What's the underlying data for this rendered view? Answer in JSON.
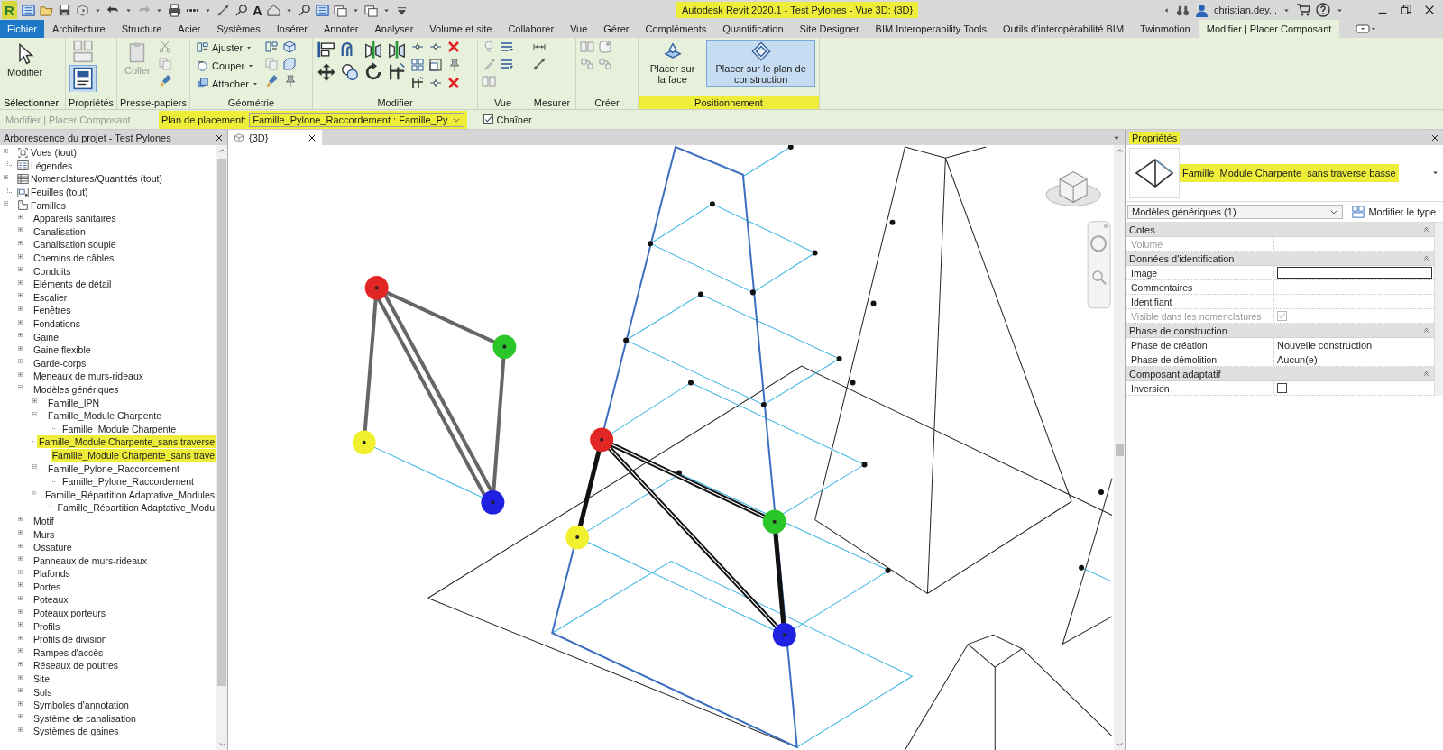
{
  "title_bar": {
    "logo": "R",
    "text_tool": "A",
    "title": "Autodesk Revit 2020.1 - Test Pylones - Vue 3D: {3D}",
    "title_highlighted": true,
    "user": "christian.dey..."
  },
  "menu_tabs": [
    {
      "label": "Fichier",
      "kind": "file",
      "selected": false
    },
    {
      "label": "Architecture",
      "kind": "tab",
      "selected": false
    },
    {
      "label": "Structure",
      "kind": "tab",
      "selected": false
    },
    {
      "label": "Acier",
      "kind": "tab",
      "selected": false
    },
    {
      "label": "Systèmes",
      "kind": "tab",
      "selected": false
    },
    {
      "label": "Insérer",
      "kind": "tab",
      "selected": false
    },
    {
      "label": "Annoter",
      "kind": "tab",
      "selected": false
    },
    {
      "label": "Analyser",
      "kind": "tab",
      "selected": false
    },
    {
      "label": "Volume et site",
      "kind": "tab",
      "selected": false
    },
    {
      "label": "Collaborer",
      "kind": "tab",
      "selected": false
    },
    {
      "label": "Vue",
      "kind": "tab",
      "selected": false
    },
    {
      "label": "Gérer",
      "kind": "tab",
      "selected": false
    },
    {
      "label": "Compléments",
      "kind": "tab",
      "selected": false
    },
    {
      "label": "Quantification",
      "kind": "tab",
      "selected": false
    },
    {
      "label": "Site Designer",
      "kind": "tab",
      "selected": false
    },
    {
      "label": "BIM Interoperability Tools",
      "kind": "tab",
      "selected": false
    },
    {
      "label": "Outils d'interopérabilité BIM",
      "kind": "tab",
      "selected": false
    },
    {
      "label": "Twinmotion",
      "kind": "tab",
      "selected": false
    },
    {
      "label": "Modifier | Placer Composant",
      "kind": "tab",
      "selected": true
    }
  ],
  "ribbon": {
    "panels": [
      {
        "label": "Sélectionner",
        "has_menu": true,
        "highlighted": false,
        "tools": [
          {
            "label": "Modifier",
            "disabled": false,
            "selected": false,
            "has_menu": false
          }
        ]
      },
      {
        "label": "Propriétés",
        "has_menu": false,
        "highlighted": false,
        "button_selected": true
      },
      {
        "label": "Presse-papiers",
        "has_menu": false,
        "highlighted": false,
        "tools": [
          {
            "label": "Coller",
            "disabled": true,
            "selected": false,
            "has_menu": false
          }
        ]
      },
      {
        "label": "Géométrie",
        "has_menu": false,
        "highlighted": false,
        "tools": [
          {
            "label": "Ajuster",
            "disabled": false,
            "selected": false,
            "has_menu": true
          },
          {
            "label": "Couper",
            "disabled": false,
            "selected": false,
            "has_menu": true
          },
          {
            "label": "Attacher",
            "disabled": false,
            "selected": false,
            "has_menu": true
          }
        ]
      },
      {
        "label": "Modifier",
        "has_menu": false,
        "highlighted": false
      },
      {
        "label": "Vue",
        "has_menu": false,
        "highlighted": false
      },
      {
        "label": "Mesurer",
        "has_menu": false,
        "highlighted": false
      },
      {
        "label": "Créer",
        "has_menu": false,
        "highlighted": false
      },
      {
        "label": "Positionnement",
        "has_menu": false,
        "highlighted": true,
        "tools": [
          {
            "label": "Placer sur la face",
            "disabled": false,
            "selected": false,
            "has_menu": false
          },
          {
            "label": "Placer sur le plan de construction",
            "disabled": false,
            "selected": true,
            "has_menu": false
          }
        ]
      }
    ]
  },
  "options_bar": {
    "context": "Modifier | Placer Composant",
    "context_disabled": true,
    "placement_label": "Plan de placement:",
    "placement_highlighted": true,
    "placement_value": "Famille_Pylone_Raccordement : Famille_Py",
    "chain": {
      "label": "Chaîner",
      "checked": true
    }
  },
  "project_browser": {
    "title": "Arborescence du projet - Test Pylones",
    "items": [
      {
        "label": "Vues (tout)",
        "kind": "group",
        "expanded": false,
        "highlighted": false
      },
      {
        "label": "Légendes",
        "kind": "leaf",
        "highlighted": false
      },
      {
        "label": "Nomenclatures/Quantités (tout)",
        "kind": "group",
        "expanded": false,
        "highlighted": false
      },
      {
        "label": "Feuilles (tout)",
        "kind": "leaf",
        "highlighted": false
      },
      {
        "label": "Familles",
        "kind": "group",
        "expanded": true,
        "highlighted": false,
        "children": [
          {
            "label": "Appareils sanitaires",
            "kind": "group",
            "expanded": false,
            "highlighted": false
          },
          {
            "label": "Canalisation",
            "kind": "group",
            "expanded": false,
            "highlighted": false
          },
          {
            "label": "Canalisation souple",
            "kind": "group",
            "expanded": false,
            "highlighted": false
          },
          {
            "label": "Chemins de câbles",
            "kind": "group",
            "expanded": false,
            "highlighted": false
          },
          {
            "label": "Conduits",
            "kind": "group",
            "expanded": false,
            "highlighted": false
          },
          {
            "label": "Eléments de détail",
            "kind": "group",
            "expanded": false,
            "highlighted": false
          },
          {
            "label": "Escalier",
            "kind": "group",
            "expanded": false,
            "highlighted": false
          },
          {
            "label": "Fenêtres",
            "kind": "group",
            "expanded": false,
            "highlighted": false
          },
          {
            "label": "Fondations",
            "kind": "group",
            "expanded": false,
            "highlighted": false
          },
          {
            "label": "Gaine",
            "kind": "group",
            "expanded": false,
            "highlighted": false
          },
          {
            "label": "Gaine flexible",
            "kind": "group",
            "expanded": false,
            "highlighted": false
          },
          {
            "label": "Garde-corps",
            "kind": "group",
            "expanded": false,
            "highlighted": false
          },
          {
            "label": "Meneaux de murs-rideaux",
            "kind": "group",
            "expanded": false,
            "highlighted": false
          },
          {
            "label": "Modèles génériques",
            "kind": "group",
            "expanded": true,
            "highlighted": false,
            "children": [
              {
                "label": "Famille_IPN",
                "kind": "group",
                "expanded": false,
                "highlighted": false
              },
              {
                "label": "Famille_Module Charpente",
                "kind": "group",
                "expanded": true,
                "highlighted": false,
                "children": [
                  {
                    "label": "Famille_Module Charpente",
                    "kind": "leaf",
                    "highlighted": false
                  }
                ]
              },
              {
                "label": "Famille_Module Charpente_sans traverse",
                "kind": "group",
                "expanded": true,
                "highlighted": true,
                "children": [
                  {
                    "label": "Famille_Module Charpente_sans trave",
                    "kind": "leaf",
                    "highlighted": true
                  }
                ]
              },
              {
                "label": "Famille_Pylone_Raccordement",
                "kind": "group",
                "expanded": true,
                "highlighted": false,
                "children": [
                  {
                    "label": "Famille_Pylone_Raccordement",
                    "kind": "leaf",
                    "highlighted": false
                  }
                ]
              },
              {
                "label": "Famille_Répartition Adaptative_Modules",
                "kind": "group",
                "expanded": true,
                "highlighted": false,
                "children": [
                  {
                    "label": "Famille_Répartition Adaptative_Modu",
                    "kind": "leaf",
                    "highlighted": false
                  }
                ]
              }
            ]
          },
          {
            "label": "Motif",
            "kind": "group",
            "expanded": false,
            "highlighted": false
          },
          {
            "label": "Murs",
            "kind": "group",
            "expanded": false,
            "highlighted": false
          },
          {
            "label": "Ossature",
            "kind": "group",
            "expanded": false,
            "highlighted": false
          },
          {
            "label": "Panneaux de murs-rideaux",
            "kind": "group",
            "expanded": false,
            "highlighted": false
          },
          {
            "label": "Plafonds",
            "kind": "group",
            "expanded": false,
            "highlighted": false
          },
          {
            "label": "Portes",
            "kind": "group",
            "expanded": false,
            "highlighted": false
          },
          {
            "label": "Poteaux",
            "kind": "group",
            "expanded": false,
            "highlighted": false
          },
          {
            "label": "Poteaux porteurs",
            "kind": "group",
            "expanded": false,
            "highlighted": false
          },
          {
            "label": "Profils",
            "kind": "group",
            "expanded": false,
            "highlighted": false
          },
          {
            "label": "Profils de division",
            "kind": "group",
            "expanded": false,
            "highlighted": false
          },
          {
            "label": "Rampes d'accès",
            "kind": "group",
            "expanded": false,
            "highlighted": false
          },
          {
            "label": "Réseaux de poutres",
            "kind": "group",
            "expanded": false,
            "highlighted": false
          },
          {
            "label": "Site",
            "kind": "group",
            "expanded": false,
            "highlighted": false
          },
          {
            "label": "Sols",
            "kind": "group",
            "expanded": false,
            "highlighted": false
          },
          {
            "label": "Symboles d'annotation",
            "kind": "group",
            "expanded": false,
            "highlighted": false
          },
          {
            "label": "Système de canalisation",
            "kind": "group",
            "expanded": false,
            "highlighted": false
          },
          {
            "label": "Systèmes de gaines",
            "kind": "group",
            "expanded": false,
            "highlighted": false
          }
        ]
      }
    ]
  },
  "view_tabs": [
    {
      "label": "{3D}",
      "selected": true
    }
  ],
  "properties": {
    "title": "Propriétés",
    "title_highlighted": true,
    "type_name": "Famille_Module Charpente_sans traverse basse",
    "type_highlighted": true,
    "filter": "Modèles génériques (1)",
    "edit_type": "Modifier le type",
    "groups": [
      {
        "label": "Cotes",
        "expanded": true,
        "rows": [
          {
            "name": "Volume",
            "kind": "text",
            "disabled": true
          }
        ]
      },
      {
        "label": "Données d'identification",
        "expanded": true,
        "rows": [
          {
            "name": "Image",
            "kind": "field",
            "disabled": false
          },
          {
            "name": "Commentaires",
            "kind": "text",
            "disabled": false
          },
          {
            "name": "Identifiant",
            "kind": "text",
            "disabled": false
          },
          {
            "name": "Visible dans les nomenclatures",
            "kind": "checkbox",
            "checked": true,
            "disabled": true
          }
        ]
      },
      {
        "label": "Phase de construction",
        "expanded": true,
        "rows": [
          {
            "name": "Phase de création",
            "kind": "text",
            "value": "Nouvelle construction",
            "disabled": false
          },
          {
            "name": "Phase de démolition",
            "kind": "text",
            "value": "Aucun(e)",
            "disabled": false
          }
        ]
      },
      {
        "label": "Composant adaptatif",
        "expanded": true,
        "rows": [
          {
            "name": "Inversion",
            "kind": "checkbox",
            "checked": false,
            "disabled": false
          }
        ]
      }
    ]
  }
}
